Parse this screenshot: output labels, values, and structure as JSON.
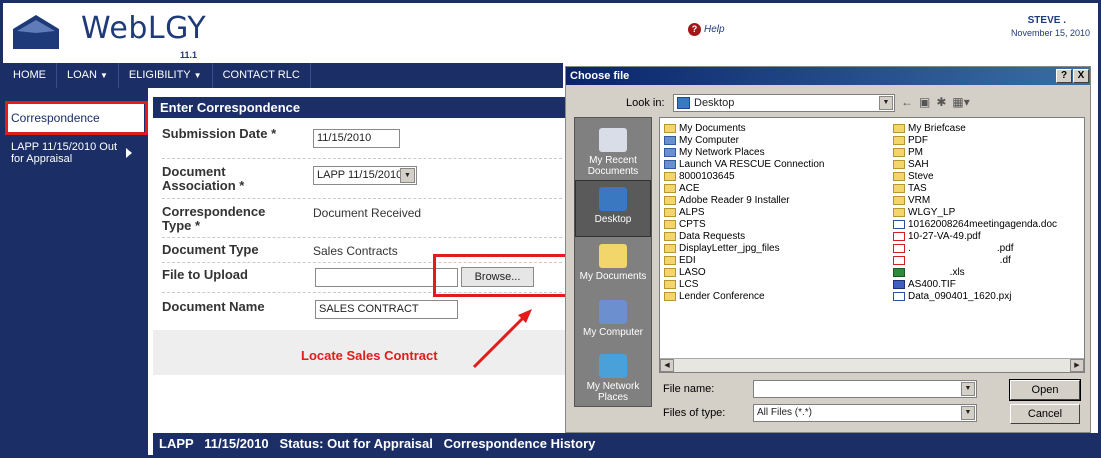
{
  "app": {
    "name": "WebLGY",
    "version": "11.1"
  },
  "header": {
    "help_label": "Help",
    "help_icon": "?",
    "user_name": "STEVE .",
    "date": "November 15, 2010"
  },
  "nav": [
    {
      "label": "HOME"
    },
    {
      "label": "LOAN",
      "caret": "▼"
    },
    {
      "label": "ELIGIBILITY",
      "caret": "▼"
    },
    {
      "label": "CONTACT RLC"
    }
  ],
  "sidebar": {
    "active": "Correspondence",
    "loan_item": "LAPP 11/15/2010 Out for Appraisal"
  },
  "form": {
    "title": "Enter Correspondence",
    "submission_date_label": "Submission Date *",
    "submission_date_value": "11/15/2010",
    "doc_assoc_label": "Document Association *",
    "doc_assoc_value": "LAPP 11/15/2010",
    "corr_type_label": "Correspondence Type *",
    "corr_type_value": "Document Received",
    "doc_type_label": "Document Type",
    "doc_type_value": "Sales Contracts",
    "file_label": "File to Upload",
    "file_value": "",
    "browse_label": "Browse...",
    "doc_name_label": "Document Name",
    "doc_name_value": "SALES CONTRACT"
  },
  "annotation": {
    "text": "Locate Sales Contract",
    "color": "#e21b1b"
  },
  "status_bar": {
    "text": "LAPP   11/15/2010   Status: Out for Appraisal   Correspondence History"
  },
  "dialog": {
    "title": "Choose file",
    "title_controls": [
      "?",
      "X"
    ],
    "look_in_label": "Look in:",
    "look_in_value": "Desktop",
    "places": [
      "My Recent Documents",
      "Desktop",
      "My Documents",
      "My Computer",
      "My Network Places"
    ],
    "files_col1": [
      {
        "name": "My Documents",
        "icon": "folder"
      },
      {
        "name": "My Computer",
        "icon": "sys"
      },
      {
        "name": "My Network Places",
        "icon": "sys"
      },
      {
        "name": "Launch VA RESCUE Connection",
        "icon": "sys"
      },
      {
        "name": "8000103645",
        "icon": "folder"
      },
      {
        "name": "ACE",
        "icon": "folder"
      },
      {
        "name": "Adobe Reader 9 Installer",
        "icon": "folder"
      },
      {
        "name": "ALPS",
        "icon": "folder"
      },
      {
        "name": "CPTS",
        "icon": "folder"
      },
      {
        "name": "Data Requests",
        "icon": "folder"
      },
      {
        "name": "DisplayLetter_jpg_files",
        "icon": "folder"
      },
      {
        "name": "EDI",
        "icon": "folder"
      },
      {
        "name": "LASO",
        "icon": "folder"
      },
      {
        "name": "LCS",
        "icon": "folder"
      },
      {
        "name": "Lender Conference",
        "icon": "folder"
      }
    ],
    "files_col2": [
      {
        "name": "My Briefcase",
        "icon": "folder"
      },
      {
        "name": "PDF",
        "icon": "folder"
      },
      {
        "name": "PM",
        "icon": "folder"
      },
      {
        "name": "SAH",
        "icon": "folder"
      },
      {
        "name": "Steve",
        "icon": "folder"
      },
      {
        "name": "TAS",
        "icon": "folder"
      },
      {
        "name": "VRM",
        "icon": "folder"
      },
      {
        "name": "WLGY_LP",
        "icon": "folder"
      },
      {
        "name": "10162008264meetingagenda.doc",
        "icon": "doc"
      },
      {
        "name": "10-27-VA-49.pdf",
        "icon": "pdf"
      },
      {
        "name": ".                               .pdf",
        "icon": "pdf"
      },
      {
        "name": "                                 .df",
        "icon": "pdf"
      },
      {
        "name": "               .xls",
        "icon": "xls"
      },
      {
        "name": "AS400.TIF",
        "icon": "tif"
      },
      {
        "name": "Data_090401_1620.pxj",
        "icon": "doc"
      }
    ],
    "file_name_label": "File name:",
    "file_name_value": "",
    "files_of_type_label": "Files of type:",
    "files_of_type_value": "All Files (*.*)",
    "open_label": "Open",
    "cancel_label": "Cancel"
  }
}
